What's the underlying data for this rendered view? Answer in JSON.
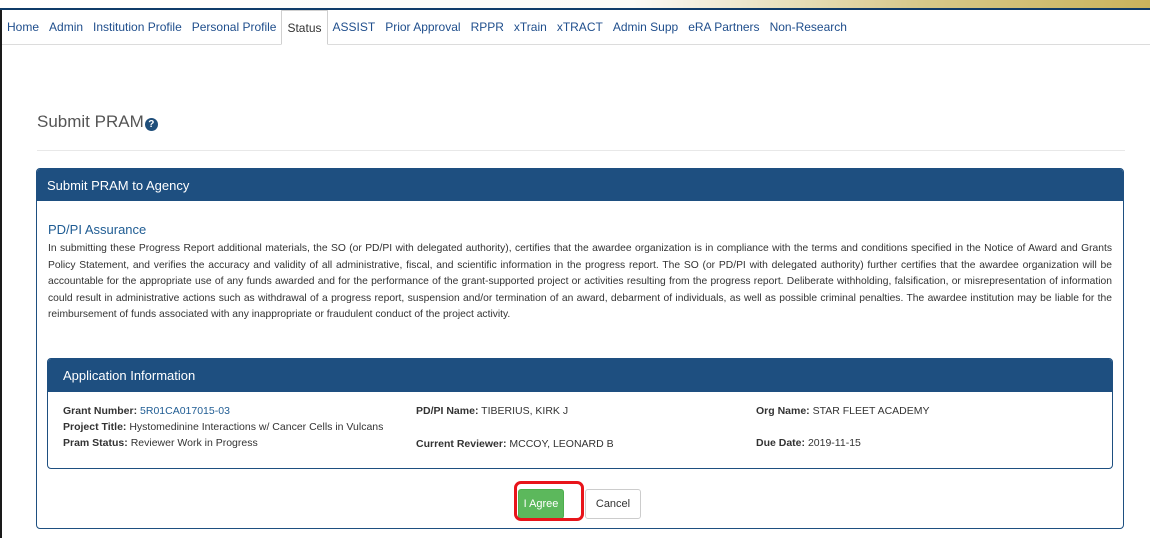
{
  "nav": {
    "items": [
      "Home",
      "Admin",
      "Institution Profile",
      "Personal Profile",
      "Status",
      "ASSIST",
      "Prior Approval",
      "RPPR",
      "xTrain",
      "xTRACT",
      "Admin Supp",
      "eRA Partners",
      "Non-Research"
    ],
    "active": "Status"
  },
  "page": {
    "title": "Submit PRAM",
    "help_icon": "question-circle-icon"
  },
  "panel": {
    "header": "Submit PRAM to Agency",
    "section_title": "PD/PI Assurance",
    "assurance_text": "In submitting these Progress Report additional materials, the SO (or PD/PI with delegated authority), certifies that the awardee organization is in compliance with the terms and conditions specified in the Notice of Award and Grants Policy Statement, and verifies the accuracy and validity of all administrative, fiscal, and scientific information in the progress report. The SO (or PD/PI with delegated authority) further certifies that the awardee organization will be accountable for the appropriate use of any funds awarded and for the performance of the grant-supported project or activities resulting from the progress report. Deliberate withholding, falsification, or misrepresentation of information could result in administrative actions such as withdrawal of a progress report, suspension and/or termination of an award, debarment of individuals, as well as possible criminal penalties. The awardee institution may be liable for the reimbursement of funds associated with any inappropriate or fraudulent conduct of the project activity."
  },
  "app_info": {
    "header": "Application Information",
    "grant_number_label": "Grant Number:",
    "grant_number": "5R01CA017015-03",
    "pdpi_label": "PD/PI Name:",
    "pdpi": "TIBERIUS, KIRK J",
    "org_label": "Org Name:",
    "org": "STAR FLEET ACADEMY",
    "project_title_label": "Project Title:",
    "project_title": "Hystomedinine Interactions w/ Cancer Cells in Vulcans",
    "pram_status_label": "Pram Status:",
    "pram_status": "Reviewer Work in Progress",
    "reviewer_label": "Current Reviewer:",
    "reviewer": "MCCOY, LEONARD B",
    "due_label": "Due Date:",
    "due": "2019-11-15"
  },
  "buttons": {
    "agree": "I Agree",
    "cancel": "Cancel"
  },
  "colors": {
    "header_blue": "#1e4f80",
    "agree_green": "#5cb85c",
    "highlight_red": "#e8141a"
  }
}
